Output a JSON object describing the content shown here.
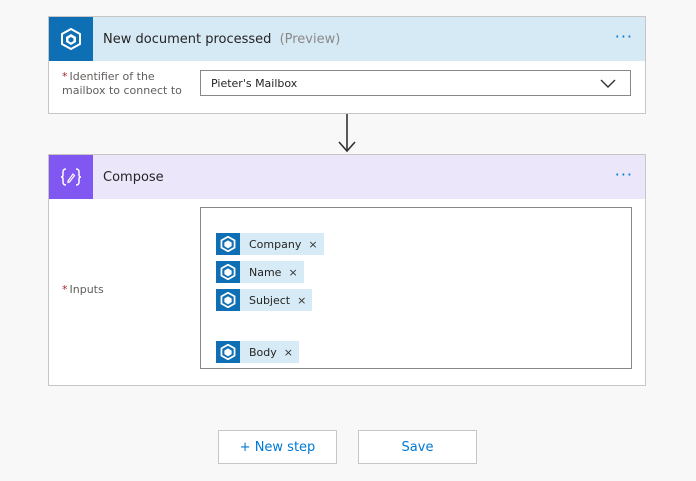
{
  "trigger": {
    "title": "New document processed",
    "preview": "(Preview)",
    "menu": "···",
    "field_label": "Identifier of the mailbox to connect to",
    "field_value": "Pieter's Mailbox",
    "required_mark": "*",
    "icon": "ai-builder-icon",
    "header_color": "#d6eaf6",
    "icon_bg": "#0f6fb5"
  },
  "compose": {
    "title": "Compose",
    "menu": "···",
    "field_label": "Inputs",
    "required_mark": "*",
    "icon": "compose-icon",
    "header_color": "#ece6fb",
    "icon_bg": "#8057f0",
    "tokens": [
      {
        "label": "Company",
        "remove": "×"
      },
      {
        "label": "Name",
        "remove": "×"
      },
      {
        "label": "Subject",
        "remove": "×"
      },
      {
        "label": "Body",
        "remove": "×"
      }
    ]
  },
  "actions": {
    "new_step": "+ New step",
    "save": "Save"
  }
}
